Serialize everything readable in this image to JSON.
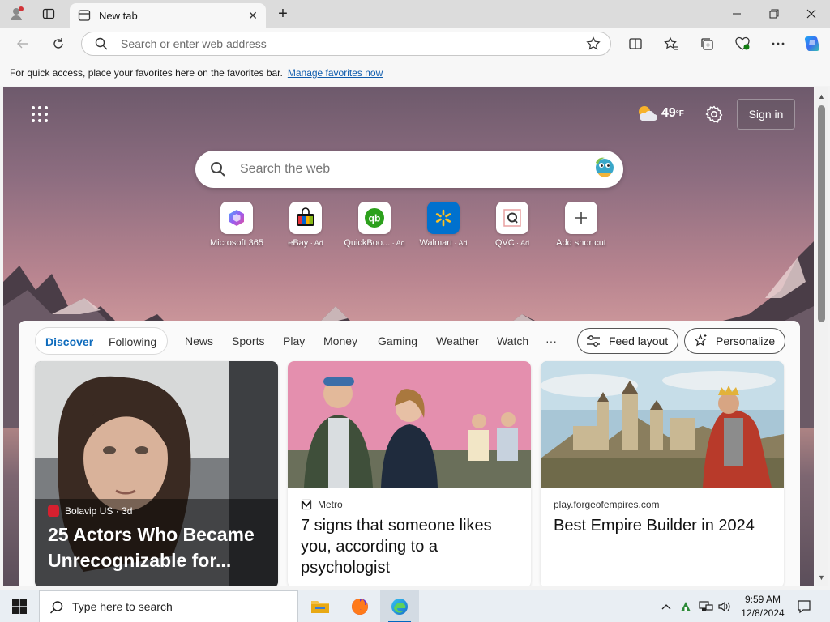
{
  "browser": {
    "tab": {
      "title": "New tab"
    },
    "address": {
      "placeholder": "Search or enter web address"
    },
    "favorites_hint": {
      "text": "For quick access, place your favorites here on the favorites bar.",
      "link": "Manage favorites now"
    }
  },
  "newtab": {
    "weather": {
      "temp": "49",
      "unit": "°F",
      "icon": "partly-cloudy-icon"
    },
    "sign_in": "Sign in",
    "search": {
      "placeholder": "Search the web"
    },
    "shortcuts": [
      {
        "label": "Microsoft 365",
        "ad": ""
      },
      {
        "label": "eBay",
        "ad": " · Ad"
      },
      {
        "label": "QuickBoo...",
        "ad": " · Ad"
      },
      {
        "label": "Walmart",
        "ad": " · Ad"
      },
      {
        "label": "QVC",
        "ad": " · Ad"
      },
      {
        "label": "Add shortcut",
        "ad": ""
      }
    ]
  },
  "feed": {
    "tabs": {
      "discover": "Discover",
      "following": "Following"
    },
    "nav": [
      "News",
      "Sports",
      "Play",
      "Money",
      "Gaming",
      "Weather",
      "Watch",
      "···"
    ],
    "feed_layout": "Feed layout",
    "personalize": "Personalize",
    "cards": [
      {
        "source": "Bolavip US · 3d",
        "title": "25 Actors Who Became Unrecognizable for..."
      },
      {
        "source": "Metro",
        "title": "7 signs that someone likes you, according to a psychologist"
      },
      {
        "source": "play.forgeofempires.com",
        "title": "Best Empire Builder in 2024"
      }
    ]
  },
  "taskbar": {
    "search_placeholder": "Type here to search",
    "time": "9:59 AM",
    "date": "12/8/2024"
  },
  "colors": {
    "accent": "#0f6cbd",
    "link": "#0f5cad",
    "taskbar": "#e9eef3"
  }
}
